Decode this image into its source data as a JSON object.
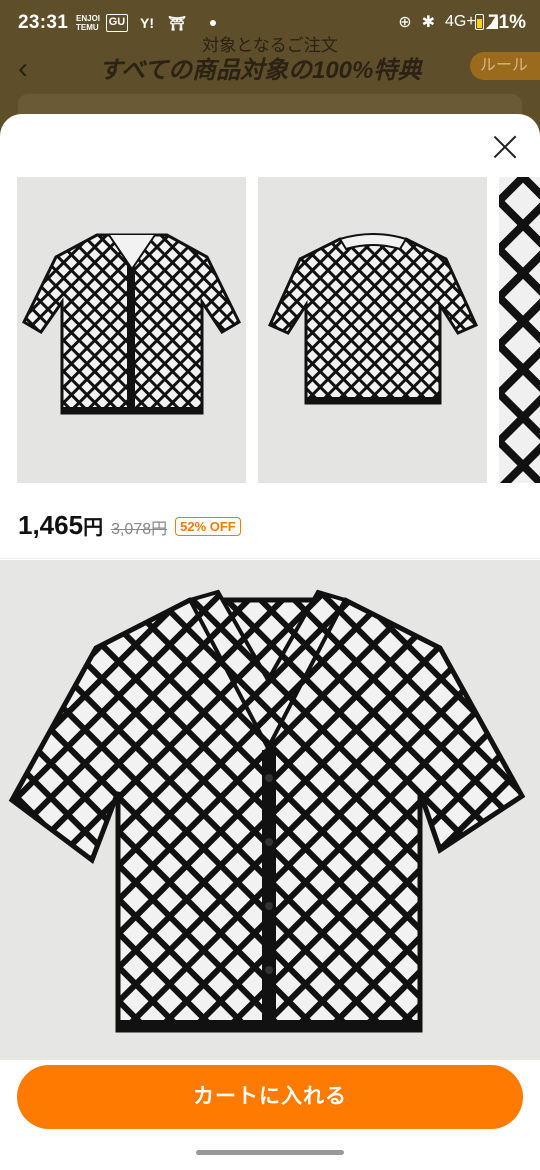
{
  "status_bar": {
    "time": "23:31",
    "apps": [
      "ENJOI TEMU",
      "GU",
      "Y!",
      "⛩"
    ],
    "network": "4G+",
    "battery": "71%"
  },
  "background_page": {
    "subtitle": "対象となるご注文",
    "title": "すべての商品対象の100%特典",
    "rule_button": "ルール"
  },
  "product": {
    "price": "1,465",
    "price_unit": "円",
    "original_price": "3,078円",
    "discount_badge": "52% OFF"
  },
  "cta": {
    "label": "カートに入れる"
  },
  "colors": {
    "accent": "#ff7a00",
    "discount": "#f07d00",
    "dim_overlay": "#5e4e2a"
  },
  "icons": [
    "back-icon",
    "close-icon",
    "bluetooth-icon",
    "signal-icon",
    "battery-icon",
    "alarm-icon"
  ]
}
